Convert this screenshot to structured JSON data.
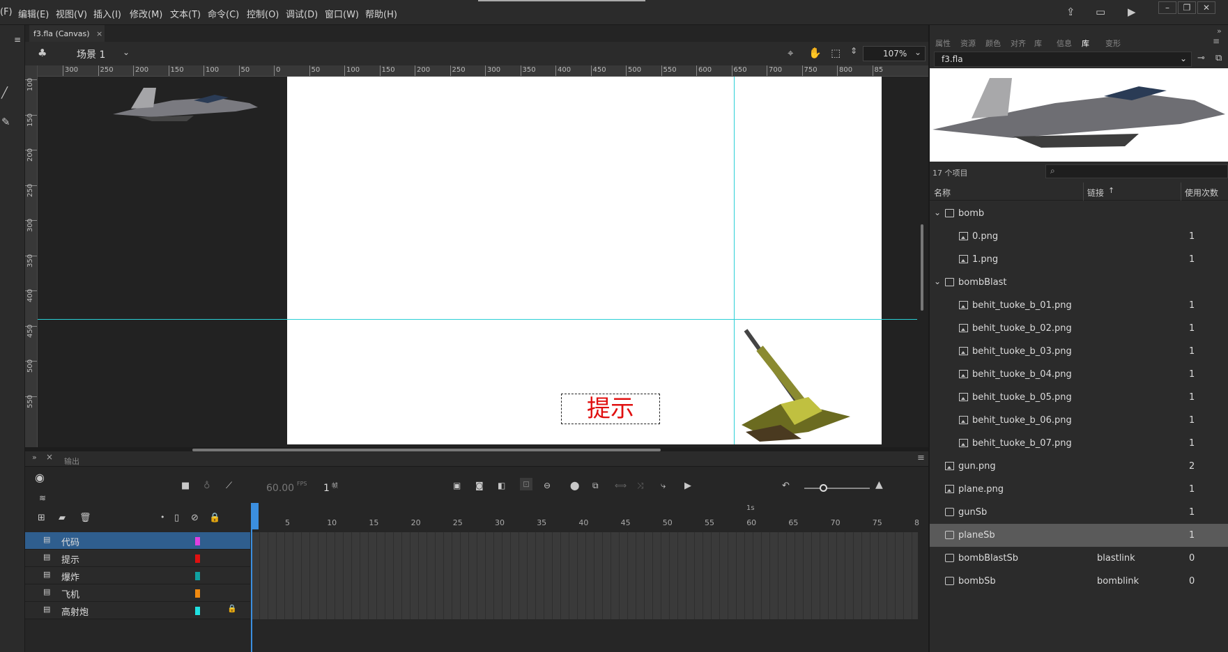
{
  "menu": [
    "(F)",
    "编辑(E)",
    "视图(V)",
    "插入(I)",
    "修改(M)",
    "文本(T)",
    "命令(C)",
    "控制(O)",
    "调试(D)",
    "窗口(W)",
    "帮助(H)"
  ],
  "document_tab": "f3.fla (Canvas)",
  "edit_bar": {
    "scene": "场景 1",
    "zoom": "107%"
  },
  "ruler_h": [
    "300",
    "250",
    "200",
    "150",
    "100",
    "50",
    "0",
    "50",
    "100",
    "150",
    "200",
    "250",
    "300",
    "350",
    "400",
    "450",
    "500",
    "550",
    "600",
    "650",
    "700",
    "750",
    "800",
    "85"
  ],
  "ruler_v": [
    "100",
    "150",
    "200",
    "250",
    "300",
    "350",
    "400",
    "450",
    "500",
    "550"
  ],
  "stage_text": "提示",
  "timeline": {
    "output_tab": "输出",
    "fps": "60.00",
    "fps_unit": "FPS",
    "frame": "1",
    "frame_unit": "帧",
    "second_marker": "1s",
    "frame_numbers": [
      "5",
      "10",
      "15",
      "20",
      "25",
      "30",
      "35",
      "40",
      "45",
      "50",
      "55",
      "60",
      "65",
      "70",
      "75",
      "8"
    ],
    "layers": [
      {
        "name": "代码",
        "color": "#e040e0",
        "selected": true,
        "locked": false
      },
      {
        "name": "提示",
        "color": "#e01010",
        "selected": false,
        "locked": false
      },
      {
        "name": "爆炸",
        "color": "#10a0a0",
        "selected": false,
        "locked": false
      },
      {
        "name": "飞机",
        "color": "#f08a10",
        "selected": false,
        "locked": false
      },
      {
        "name": "高射炮",
        "color": "#20e0e0",
        "selected": false,
        "locked": true
      }
    ]
  },
  "right_panel": {
    "tabs": [
      "属性",
      "资源",
      "颜色",
      "对齐",
      "库",
      "信息",
      "库",
      "变形"
    ],
    "active_tab": 6,
    "library_file": "f3.fla",
    "item_count": "17 个项目",
    "columns": {
      "name": "名称",
      "link": "链接",
      "usage": "使用次数"
    },
    "items": [
      {
        "name": "bomb",
        "type": "folder",
        "level": 0,
        "link": "",
        "count": ""
      },
      {
        "name": "0.png",
        "type": "bitmap",
        "level": 1,
        "link": "",
        "count": "1"
      },
      {
        "name": "1.png",
        "type": "bitmap",
        "level": 1,
        "link": "",
        "count": "1"
      },
      {
        "name": "bombBlast",
        "type": "folder",
        "level": 0,
        "link": "",
        "count": ""
      },
      {
        "name": "behit_tuoke_b_01.png",
        "type": "bitmap",
        "level": 1,
        "link": "",
        "count": "1"
      },
      {
        "name": "behit_tuoke_b_02.png",
        "type": "bitmap",
        "level": 1,
        "link": "",
        "count": "1"
      },
      {
        "name": "behit_tuoke_b_03.png",
        "type": "bitmap",
        "level": 1,
        "link": "",
        "count": "1"
      },
      {
        "name": "behit_tuoke_b_04.png",
        "type": "bitmap",
        "level": 1,
        "link": "",
        "count": "1"
      },
      {
        "name": "behit_tuoke_b_05.png",
        "type": "bitmap",
        "level": 1,
        "link": "",
        "count": "1"
      },
      {
        "name": "behit_tuoke_b_06.png",
        "type": "bitmap",
        "level": 1,
        "link": "",
        "count": "1"
      },
      {
        "name": "behit_tuoke_b_07.png",
        "type": "bitmap",
        "level": 1,
        "link": "",
        "count": "1"
      },
      {
        "name": "gun.png",
        "type": "bitmap",
        "level": 0,
        "link": "",
        "count": "2"
      },
      {
        "name": "plane.png",
        "type": "bitmap",
        "level": 0,
        "link": "",
        "count": "1"
      },
      {
        "name": "gunSb",
        "type": "button",
        "level": 0,
        "link": "",
        "count": "1"
      },
      {
        "name": "planeSb",
        "type": "symbol",
        "level": 0,
        "link": "",
        "count": "1",
        "selected": true
      },
      {
        "name": "bombBlastSb",
        "type": "symbol",
        "level": 0,
        "link": "blastlink",
        "count": "0"
      },
      {
        "name": "bombSb",
        "type": "symbol",
        "level": 0,
        "link": "bomblink",
        "count": "0"
      }
    ]
  }
}
